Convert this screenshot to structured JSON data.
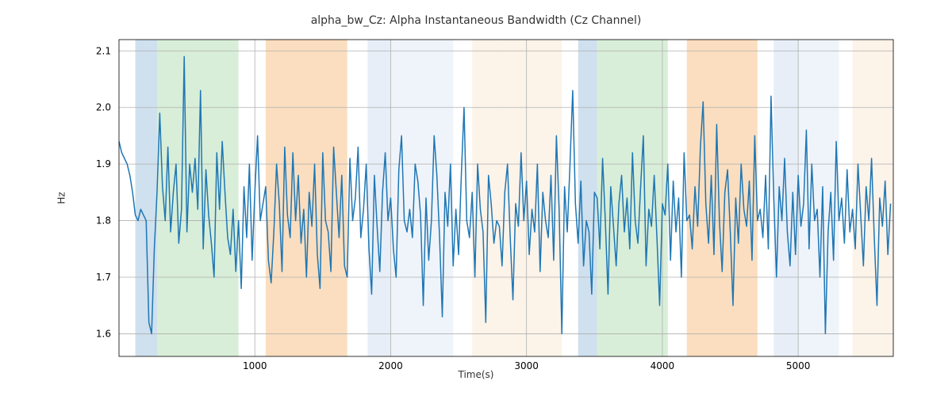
{
  "chart_data": {
    "type": "line",
    "title": "alpha_bw_Cz: Alpha Instantaneous Bandwidth (Cz Channel)",
    "xlabel": "Time(s)",
    "ylabel": "Hz",
    "xlim": [
      0,
      5700
    ],
    "ylim": [
      1.56,
      2.12
    ],
    "xticks": [
      1000,
      2000,
      3000,
      4000,
      5000
    ],
    "yticks": [
      1.6,
      1.7,
      1.8,
      1.9,
      2.0,
      2.1
    ],
    "shaded_regions": [
      {
        "x0": 120,
        "x1": 280,
        "color": "#a8c6e0",
        "alpha": 0.55
      },
      {
        "x0": 280,
        "x1": 880,
        "color": "#b8e0b8",
        "alpha": 0.55
      },
      {
        "x0": 1080,
        "x1": 1680,
        "color": "#f5c38a",
        "alpha": 0.55
      },
      {
        "x0": 1830,
        "x1": 2000,
        "color": "#c9d9ee",
        "alpha": 0.45
      },
      {
        "x0": 2000,
        "x1": 2460,
        "color": "#dbe7f4",
        "alpha": 0.45
      },
      {
        "x0": 2600,
        "x1": 2800,
        "color": "#f9e4cf",
        "alpha": 0.45
      },
      {
        "x0": 2800,
        "x1": 3260,
        "color": "#f9e4cf",
        "alpha": 0.45
      },
      {
        "x0": 3380,
        "x1": 3520,
        "color": "#a8c6e0",
        "alpha": 0.55
      },
      {
        "x0": 3520,
        "x1": 4040,
        "color": "#b8e0b8",
        "alpha": 0.55
      },
      {
        "x0": 4180,
        "x1": 4700,
        "color": "#f5c38a",
        "alpha": 0.55
      },
      {
        "x0": 4820,
        "x1": 5000,
        "color": "#c9d9ee",
        "alpha": 0.45
      },
      {
        "x0": 5000,
        "x1": 5300,
        "color": "#dbe7f4",
        "alpha": 0.45
      },
      {
        "x0": 5400,
        "x1": 5700,
        "color": "#f9e4cf",
        "alpha": 0.45
      }
    ],
    "series": [
      {
        "name": "alpha_bw_Cz",
        "color": "#1f77b4",
        "x_start": 0,
        "x_step": 20,
        "y": [
          1.94,
          1.92,
          1.91,
          1.9,
          1.88,
          1.85,
          1.81,
          1.8,
          1.82,
          1.81,
          1.8,
          1.62,
          1.6,
          1.75,
          1.85,
          1.99,
          1.86,
          1.8,
          1.93,
          1.78,
          1.85,
          1.9,
          1.76,
          1.82,
          2.09,
          1.78,
          1.9,
          1.85,
          1.91,
          1.82,
          2.03,
          1.75,
          1.89,
          1.81,
          1.76,
          1.7,
          1.92,
          1.82,
          1.94,
          1.85,
          1.77,
          1.74,
          1.82,
          1.71,
          1.8,
          1.68,
          1.86,
          1.77,
          1.9,
          1.73,
          1.85,
          1.95,
          1.8,
          1.83,
          1.86,
          1.73,
          1.69,
          1.78,
          1.9,
          1.83,
          1.71,
          1.93,
          1.81,
          1.77,
          1.92,
          1.8,
          1.88,
          1.76,
          1.82,
          1.7,
          1.85,
          1.79,
          1.9,
          1.74,
          1.68,
          1.92,
          1.8,
          1.78,
          1.71,
          1.93,
          1.85,
          1.77,
          1.88,
          1.72,
          1.7,
          1.91,
          1.8,
          1.84,
          1.93,
          1.77,
          1.82,
          1.9,
          1.75,
          1.67,
          1.88,
          1.79,
          1.71,
          1.85,
          1.92,
          1.8,
          1.84,
          1.75,
          1.7,
          1.89,
          1.95,
          1.8,
          1.78,
          1.82,
          1.77,
          1.9,
          1.87,
          1.81,
          1.65,
          1.84,
          1.73,
          1.8,
          1.95,
          1.88,
          1.77,
          1.63,
          1.85,
          1.79,
          1.9,
          1.72,
          1.82,
          1.74,
          1.88,
          2.0,
          1.8,
          1.77,
          1.85,
          1.7,
          1.9,
          1.82,
          1.78,
          1.62,
          1.88,
          1.83,
          1.76,
          1.8,
          1.79,
          1.72,
          1.85,
          1.9,
          1.77,
          1.66,
          1.83,
          1.79,
          1.92,
          1.8,
          1.87,
          1.74,
          1.82,
          1.78,
          1.9,
          1.71,
          1.85,
          1.8,
          1.77,
          1.88,
          1.73,
          1.95,
          1.82,
          1.6,
          1.86,
          1.78,
          1.9,
          2.03,
          1.83,
          1.76,
          1.87,
          1.72,
          1.8,
          1.78,
          1.67,
          1.85,
          1.84,
          1.75,
          1.91,
          1.8,
          1.67,
          1.86,
          1.79,
          1.72,
          1.83,
          1.88,
          1.78,
          1.84,
          1.75,
          1.92,
          1.8,
          1.76,
          1.86,
          1.95,
          1.72,
          1.82,
          1.79,
          1.88,
          1.77,
          1.65,
          1.83,
          1.81,
          1.9,
          1.73,
          1.87,
          1.78,
          1.84,
          1.7,
          1.92,
          1.8,
          1.81,
          1.75,
          1.86,
          1.79,
          1.93,
          2.01,
          1.83,
          1.76,
          1.88,
          1.74,
          1.97,
          1.8,
          1.71,
          1.85,
          1.89,
          1.78,
          1.65,
          1.84,
          1.76,
          1.9,
          1.82,
          1.79,
          1.87,
          1.73,
          1.95,
          1.8,
          1.82,
          1.77,
          1.88,
          1.75,
          2.02,
          1.84,
          1.7,
          1.86,
          1.8,
          1.91,
          1.78,
          1.72,
          1.85,
          1.74,
          1.88,
          1.79,
          1.83,
          1.96,
          1.75,
          1.9,
          1.8,
          1.82,
          1.7,
          1.86,
          1.6,
          1.78,
          1.85,
          1.73,
          1.94,
          1.8,
          1.84,
          1.76,
          1.89,
          1.78,
          1.82,
          1.75,
          1.9,
          1.81,
          1.72,
          1.86,
          1.8,
          1.91,
          1.77,
          1.65,
          1.84,
          1.79,
          1.87,
          1.74,
          1.83
        ]
      }
    ]
  }
}
